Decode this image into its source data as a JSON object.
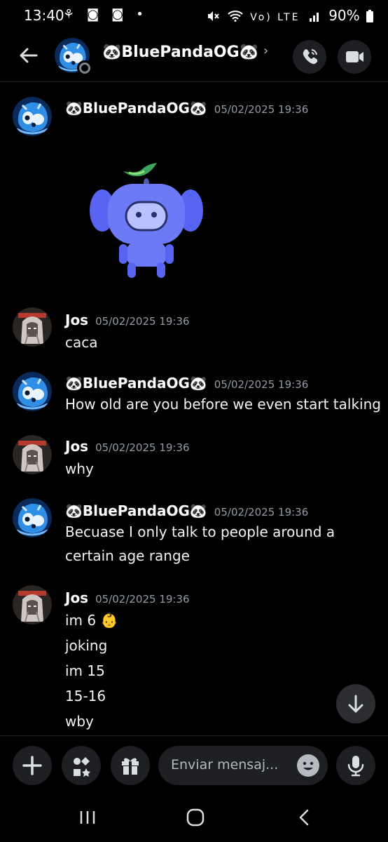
{
  "status_bar": {
    "time": "13:40",
    "left_icons": "⚘ ◙ ◙ •",
    "network": "Vo) LTE",
    "battery": "90%"
  },
  "header": {
    "name": "🐼BluePandaOG🐼",
    "chevron": "›"
  },
  "messages": [
    {
      "author": "🐼BluePandaOG🐼",
      "time": "05/02/2025 19:36",
      "avatar": "panda",
      "sticker": "wumpus-leaf"
    },
    {
      "author": "Jos",
      "time": "05/02/2025 19:36",
      "avatar": "jos",
      "lines": [
        "caca"
      ]
    },
    {
      "author": "🐼BluePandaOG🐼",
      "time": "05/02/2025 19:36",
      "avatar": "panda",
      "lines": [
        "How old are you before we even start talking"
      ]
    },
    {
      "author": "Jos",
      "time": "05/02/2025 19:36",
      "avatar": "jos",
      "lines": [
        "why"
      ]
    },
    {
      "author": "🐼BluePandaOG🐼",
      "time": "05/02/2025 19:36",
      "avatar": "panda",
      "lines": [
        "Becuase I only talk to people around a",
        "certain age range"
      ]
    },
    {
      "author": "Jos",
      "time": "05/02/2025 19:36",
      "avatar": "jos",
      "lines": [
        "im 6 👶",
        "joking",
        "im 15",
        "15-16",
        "wby"
      ]
    }
  ],
  "composer": {
    "placeholder": "Enviar mensaj..."
  },
  "icons": {
    "back": "arrow-left-icon",
    "call": "phone-icon",
    "video": "video-camera-icon",
    "plus": "plus-icon",
    "apps": "apps-icon",
    "gift": "gift-icon",
    "emoji": "emoji-icon",
    "mic": "microphone-icon",
    "scroll": "arrow-down-icon"
  },
  "colors": {
    "background": "#000000",
    "surface": "#1e1f22",
    "muted_text": "#949ba4",
    "text": "#f2f3f5"
  }
}
